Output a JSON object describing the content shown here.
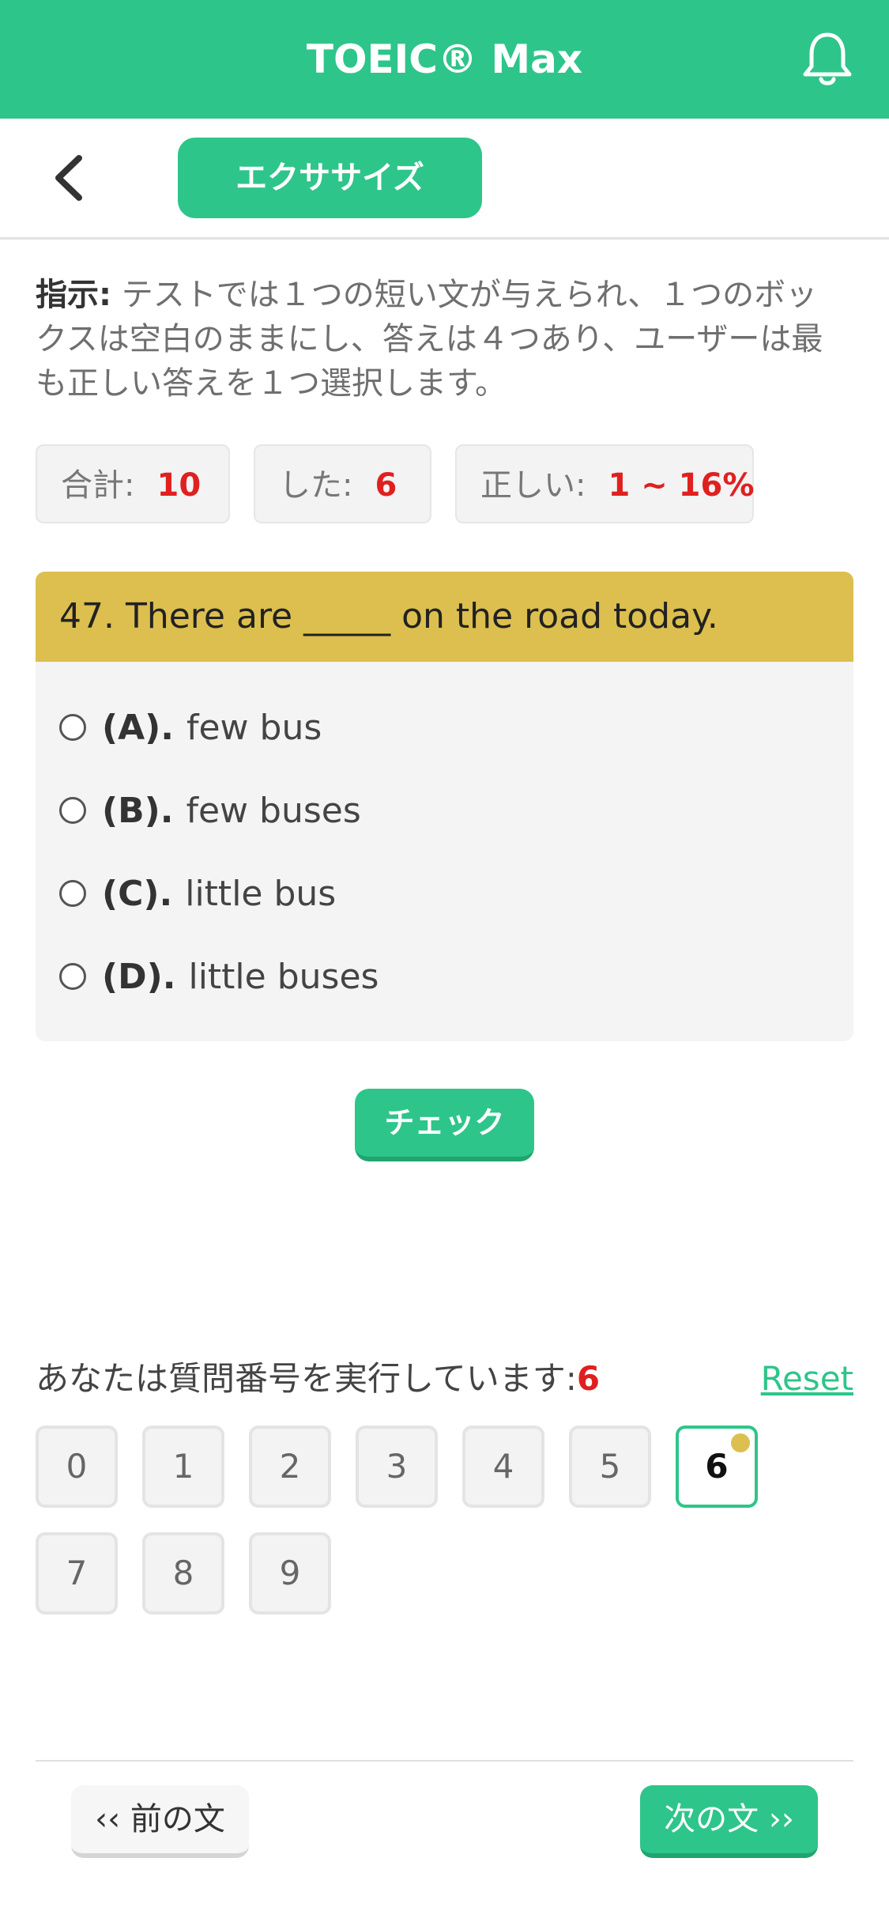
{
  "app": {
    "title": "TOEIC® Max"
  },
  "header": {
    "exercise_label": "エクササイズ"
  },
  "instructions": {
    "label": "指示:",
    "text": " テストでは１つの短い文が与えられ、１つのボックスは空白のままにし、答えは４つあり、ユーザーは最も正しい答えを１つ選択します。"
  },
  "stats": {
    "total_label": "合計:",
    "total_value": "10",
    "done_label": "した:",
    "done_value": "6",
    "correct_label": "正しい:",
    "correct_value": "1 ~ 16%"
  },
  "question": {
    "text": "47. There are _____ on the road today.",
    "options": [
      {
        "label": "(A).",
        "text": "few bus"
      },
      {
        "label": "(B).",
        "text": "few buses"
      },
      {
        "label": "(C).",
        "text": "little bus"
      },
      {
        "label": "(D).",
        "text": "little buses"
      }
    ]
  },
  "check_label": "チェック",
  "progress": {
    "running_label": "あなたは質問番号を実行しています:",
    "current": "6",
    "reset_label": "Reset",
    "numbers": [
      "0",
      "1",
      "2",
      "3",
      "4",
      "5",
      "6",
      "7",
      "8",
      "9"
    ]
  },
  "nav": {
    "prev_label": "‹‹ 前の文",
    "next_label": "次の文 ››"
  },
  "colors": {
    "accent": "#2ec58a",
    "question_header": "#dcbf4e",
    "highlight": "#e02020"
  },
  "icons": {
    "bell": "bell-icon",
    "back": "back-chevron-icon",
    "radio": "radio-unchecked-icon"
  }
}
